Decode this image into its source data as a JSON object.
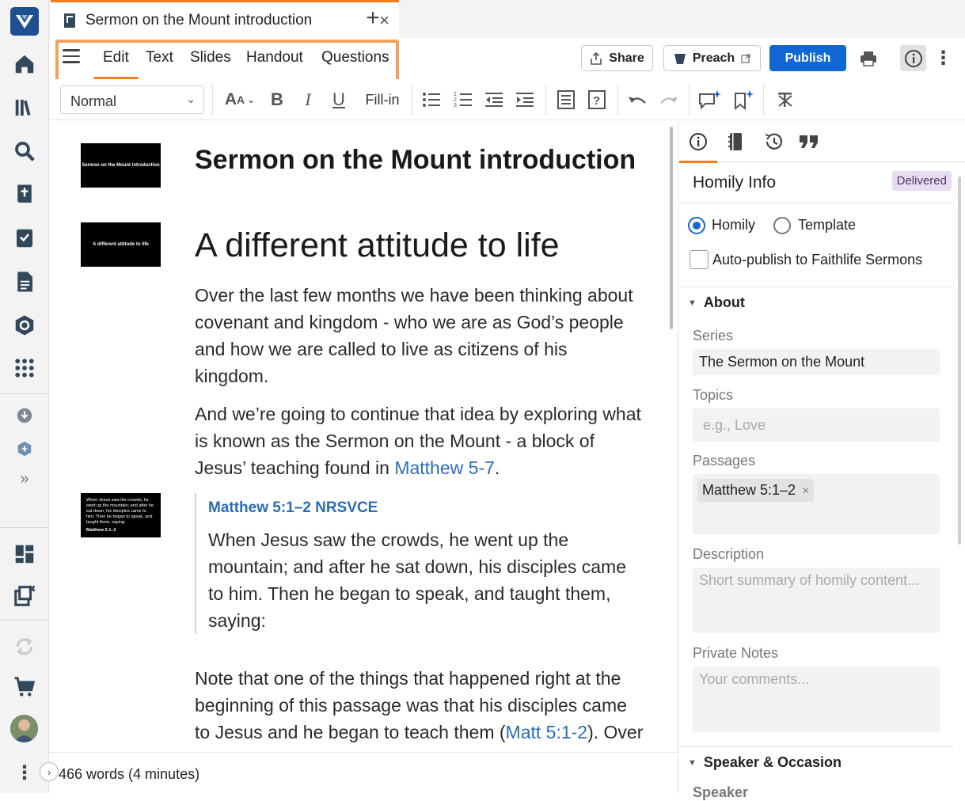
{
  "tab": {
    "title": "Sermon on the Mount introduction",
    "close": "×",
    "add": "+"
  },
  "menu": {
    "items": [
      "Edit",
      "Text",
      "Slides",
      "Handout",
      "Questions"
    ]
  },
  "actions": {
    "share": "Share",
    "preach": "Preach",
    "publish": "Publish"
  },
  "format": {
    "style_select": "Normal",
    "fill_in": "Fill-in"
  },
  "document": {
    "title": "Sermon on the Mount introduction",
    "heading": "A different attitude to life",
    "para1": "Over the last few months we have been thinking about covenant and kingdom - who we are as God’s people and how we are called to live as citizens of his kingdom.",
    "para2_start": "And we’re going to continue that idea by exploring what is known as the Sermon on the Mount - a block of Jesus’ teaching found in ",
    "para2_link": "Matthew 5-7",
    "para2_end": ".",
    "quote_ref": "Matthew 5:1–2 NRSVCE",
    "quote_text": "When Jesus saw the crowds, he went up the mountain; and after he sat down, his disciples came to him. Then he began to speak, and taught them, saying:",
    "para3_start": "Note that one of the things that happened right at the beginning of this passage was that his disciples came to Jesus and he began to teach them (",
    "para3_link": "Matt 5:1-2",
    "para3_end": "). Over",
    "slide1": "Sermon on the Mount introduction",
    "slide2": "A different attitude to life",
    "slide3_text": "When Jesus saw the crowds, he went up the mountain; and after he sat down, his disciples came to him. Then he began to speak, and taught them, saying:",
    "slide3_ref": "Matthew 5:1–2"
  },
  "status": {
    "word_count": "466 words (4 minutes)",
    "expand": "›"
  },
  "panel": {
    "title": "Homily Info",
    "badge": "Delivered",
    "radio_homily": "Homily",
    "radio_template": "Template",
    "autopublish": "Auto-publish to Faithlife Sermons",
    "about": "About",
    "series_label": "Series",
    "series_value": "The Sermon on the Mount",
    "topics_label": "Topics",
    "topics_placeholder": "e.g., Love",
    "passages_label": "Passages",
    "passage_chip": "Matthew 5:1–2",
    "chip_remove": "×",
    "description_label": "Description",
    "description_placeholder": "Short summary of homily content...",
    "notes_label": "Private Notes",
    "notes_placeholder": "Your comments...",
    "speaker_section": "Speaker & Occasion",
    "speaker_label": "Speaker"
  },
  "colors": {
    "accent": "#f07c1b",
    "publish": "#1167d3",
    "link": "#2a6db8",
    "badge": "#e8dcf3"
  },
  "icons": [
    "logo-icon",
    "home-icon",
    "library-icon",
    "search-icon",
    "bible-icon",
    "checklist-icon",
    "document-icon",
    "guide-icon",
    "apps-icon",
    "download-icon",
    "add-on-icon",
    "more-chevrons-icon",
    "layout-icon",
    "close-panels-icon",
    "sync-icon",
    "cart-icon",
    "avatar",
    "more-vertical-icon"
  ]
}
